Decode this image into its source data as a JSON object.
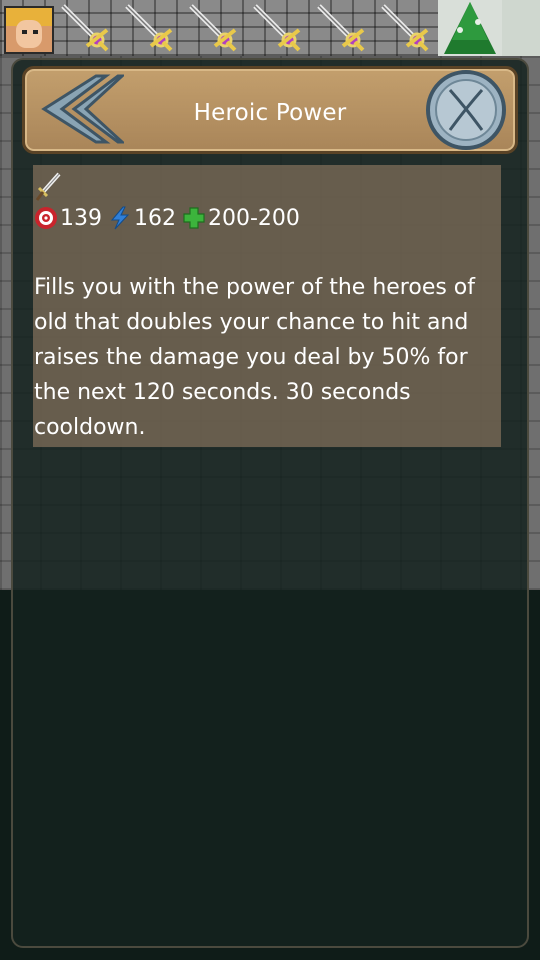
{
  "topbar": {
    "portrait_icon": "hero-portrait-icon",
    "slots": [
      "sword-icon",
      "sword-icon",
      "sword-icon",
      "sword-icon",
      "sword-icon",
      "sword-icon"
    ]
  },
  "dialog": {
    "title": "Heroic Power",
    "back_icon": "double-chevron-left-icon",
    "close_icon": "close-x-icon",
    "skill": {
      "icon": "sword-icon",
      "stats": {
        "accuracy": "139",
        "energy": "162",
        "heal": "200-200"
      },
      "description": "Fills you with the power of the heroes of old that doubles your chance to hit and raises the damage you deal by 50% for the next 120 seconds. 30 seconds cooldown."
    }
  },
  "colors": {
    "header_bg": "#b8946a",
    "panel_bg": "#1a2a25",
    "text": "#ffffff",
    "accuracy_red": "#c9242c",
    "energy_blue": "#2f7fd8",
    "heal_green": "#3cb43c"
  }
}
